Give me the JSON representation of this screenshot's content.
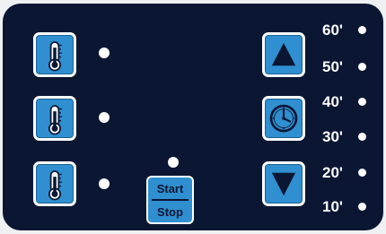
{
  "panel": {
    "buttons": {
      "temperature_icons": [
        "thermometer-icon",
        "thermometer-icon",
        "thermometer-icon"
      ],
      "up_icon": "triangle-up-icon",
      "timer_icon": "clock-icon",
      "down_icon": "triangle-down-icon"
    },
    "start_stop": {
      "start_label": "Start",
      "stop_label": "Stop"
    },
    "time_labels": [
      "60'",
      "50'",
      "40'",
      "30'",
      "20'",
      "10'"
    ]
  },
  "colors": {
    "panel_background": "#0b1633",
    "button_fill": "#2f8fd0",
    "button_border": "#ffffff",
    "indicator": "#ffffff"
  }
}
